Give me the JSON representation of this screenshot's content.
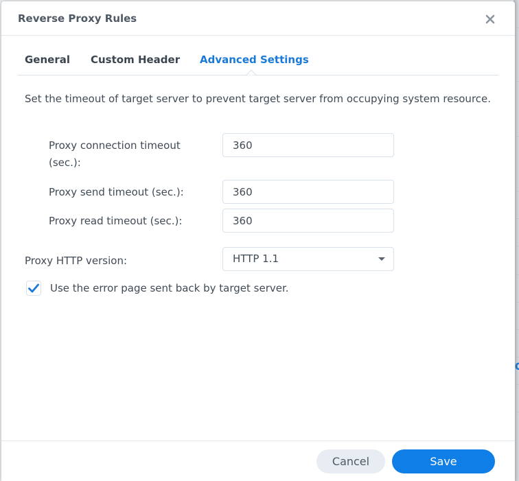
{
  "dialog": {
    "title": "Reverse Proxy Rules",
    "close_icon": "close-icon"
  },
  "tabs": [
    {
      "label": "General",
      "active": false
    },
    {
      "label": "Custom Header",
      "active": false
    },
    {
      "label": "Advanced Settings",
      "active": true
    }
  ],
  "content": {
    "description": "Set the timeout of target server to prevent target server from occupying system resource.",
    "fields": {
      "connection_timeout": {
        "label_line1": "Proxy connection timeout",
        "label_line2": "(sec.):",
        "value": "360"
      },
      "send_timeout": {
        "label": "Proxy send timeout (sec.):",
        "value": "360"
      },
      "read_timeout": {
        "label": "Proxy read timeout (sec.):",
        "value": "360"
      },
      "http_version": {
        "label": "Proxy HTTP version:",
        "selected": "HTTP 1.1"
      }
    },
    "error_page_checkbox": {
      "label": "Use the error page sent back by target server.",
      "checked": true
    }
  },
  "footer": {
    "cancel_label": "Cancel",
    "save_label": "Save"
  },
  "colors": {
    "accent": "#0f7ee6",
    "active_tab": "#1a79d6",
    "text": "#414b55",
    "cancel_bg": "#e8edf3"
  }
}
